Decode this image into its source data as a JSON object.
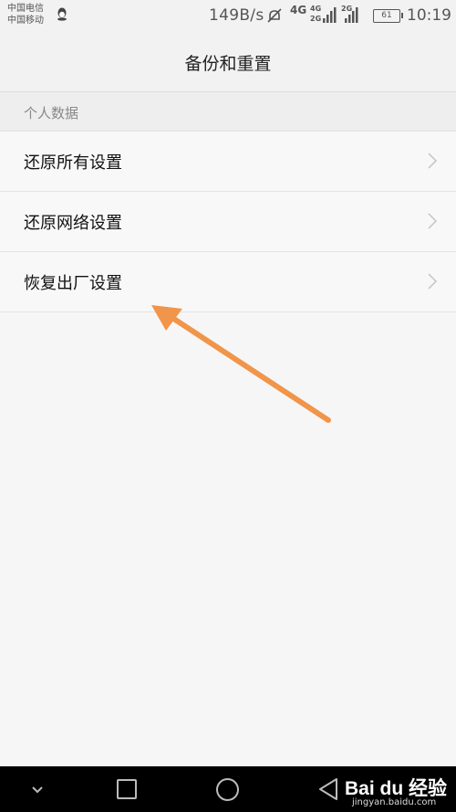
{
  "status_bar": {
    "carrier_1": "中国电信",
    "carrier_2": "中国移动",
    "net_speed": "149B/s",
    "network_type": "4G",
    "signal_1_label_top": "4G",
    "signal_1_label_bottom": "2G",
    "signal_2_label": "2G",
    "battery_level": "61",
    "time": "10:19",
    "icons": [
      "qq-icon",
      "mute-icon",
      "signal-icon",
      "battery-icon"
    ]
  },
  "header": {
    "title": "备份和重置"
  },
  "section": {
    "label": "个人数据"
  },
  "list": {
    "items": [
      {
        "label": "还原所有设置"
      },
      {
        "label": "还原网络设置"
      },
      {
        "label": "恢复出厂设置"
      }
    ]
  },
  "annotation": {
    "color": "#f0954a"
  },
  "nav_bar": {
    "icons": [
      "chevron-down-icon",
      "recent-apps-icon",
      "home-icon",
      "back-icon"
    ]
  },
  "watermark": {
    "brand": "Bai du 经验",
    "url": "jingyan.baidu.com"
  }
}
